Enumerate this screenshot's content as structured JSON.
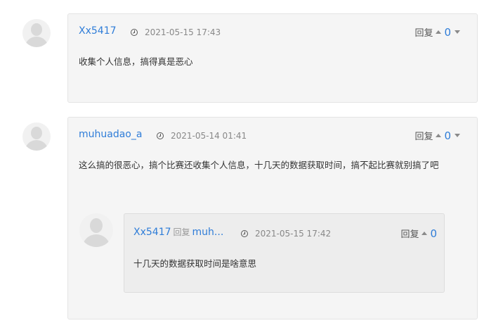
{
  "comments": [
    {
      "user": "Xx5417",
      "time": "2021-05-15 17:43",
      "reply_label": "回复",
      "votes": "0",
      "content": "收集个人信息，搞得真是恶心"
    },
    {
      "user": "muhuadao_a",
      "time": "2021-05-14 01:41",
      "reply_label": "回复",
      "votes": "0",
      "content": "这么搞的很恶心，搞个比赛还收集个人信息，十几天的数据获取时间，搞不起比赛就别搞了吧",
      "replies": [
        {
          "user": "Xx5417",
          "reply_word": "回复",
          "target": "muh...",
          "time": "2021-05-15 17:42",
          "reply_label": "回复",
          "votes": "0",
          "content": "十几天的数据获取时间是啥意思"
        }
      ]
    }
  ],
  "colors": {
    "accent": "#2f7dd8",
    "card_bg": "#f5f5f5",
    "reply_bg": "#ededed"
  }
}
